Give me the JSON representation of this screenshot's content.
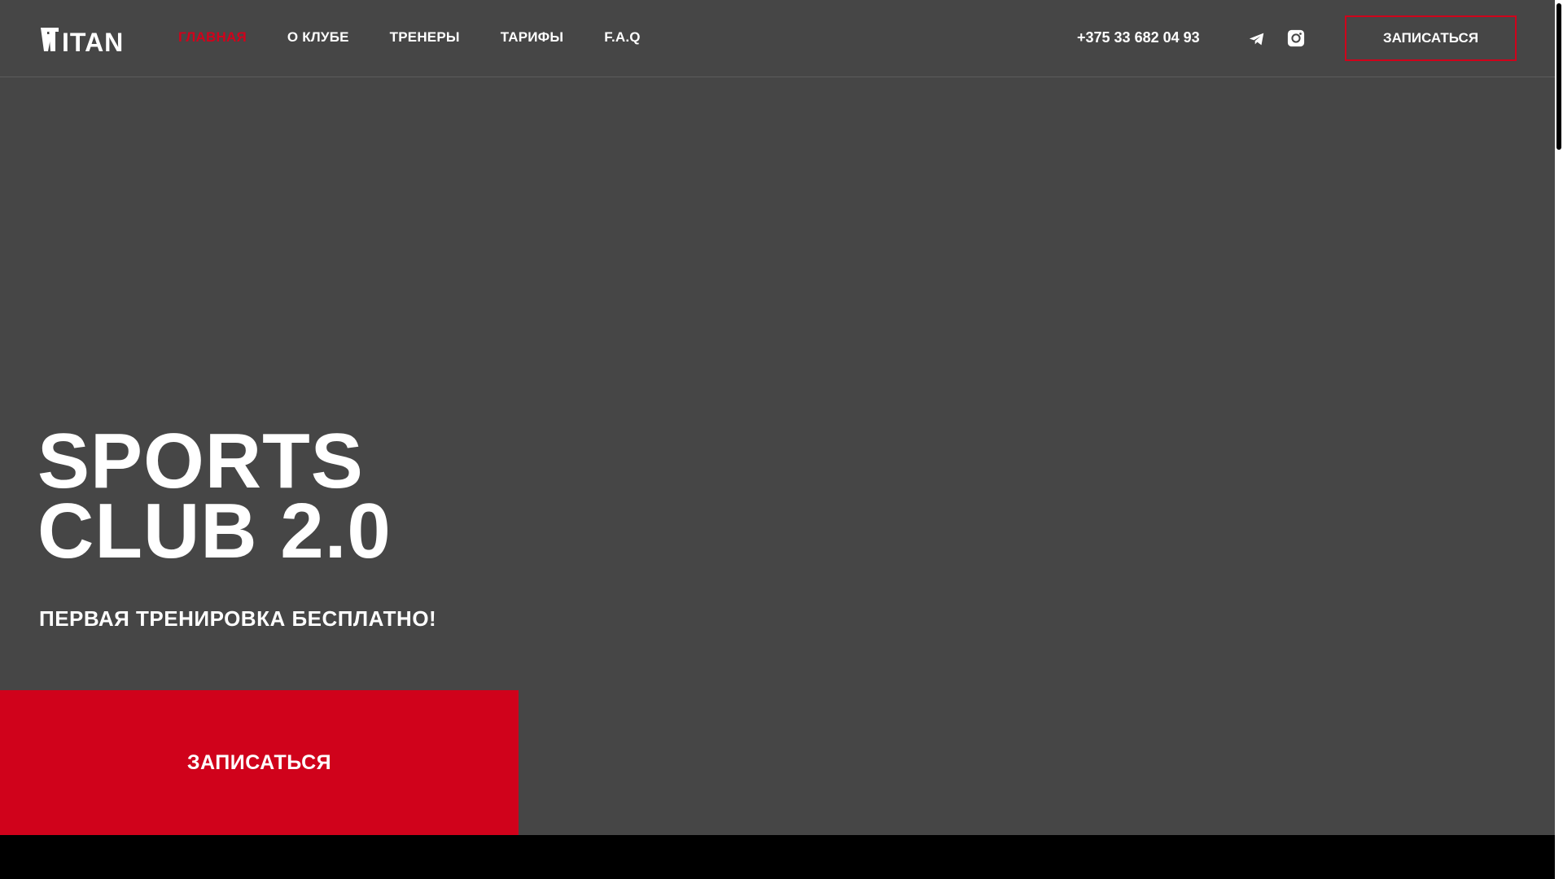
{
  "header": {
    "logo_text": "TITAN",
    "nav": [
      {
        "label": "ГЛАВНАЯ",
        "active": true
      },
      {
        "label": "О КЛУБЕ",
        "active": false
      },
      {
        "label": "ТРЕНЕРЫ",
        "active": false
      },
      {
        "label": "ТАРИФЫ",
        "active": false
      },
      {
        "label": "F.A.Q",
        "active": false
      }
    ],
    "phone": "+375 33 682 04 93",
    "social_icons": [
      "telegram-icon",
      "instagram-icon"
    ],
    "cta_label": "ЗАПИСАТЬСЯ"
  },
  "hero": {
    "title_line1": "SPORTS",
    "title_line2": "CLUB 2.0",
    "subtitle": "ПЕРВАЯ ТРЕНИРОВКА БЕСПЛАТНО!",
    "cta_label": "ЗАПИСАТЬСЯ"
  },
  "colors": {
    "background": "#464646",
    "accent": "#d0021b",
    "text": "#ffffff",
    "footer": "#000000"
  }
}
